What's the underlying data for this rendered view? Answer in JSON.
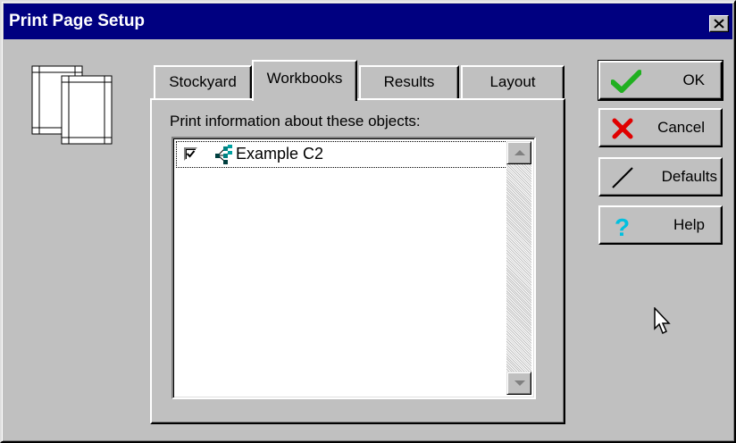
{
  "window": {
    "title": "Print Page Setup"
  },
  "icons": {
    "close": "close-icon",
    "page_setup": "pages-icon",
    "object_tree": "tree-icon",
    "ok": "checkmark-icon",
    "cancel": "x-icon",
    "defaults": "slash-icon",
    "help": "question-icon",
    "cursor": "mouse-pointer-icon"
  },
  "tabs": [
    {
      "label": "Stockyard",
      "active": false
    },
    {
      "label": "Workbooks",
      "active": true
    },
    {
      "label": "Results",
      "active": false
    },
    {
      "label": "Layout",
      "active": false
    }
  ],
  "panel": {
    "label": "Print information about these objects:",
    "items": [
      {
        "label": "Example C2",
        "checked": true
      }
    ]
  },
  "buttons": {
    "ok": "OK",
    "cancel": "Cancel",
    "defaults": "Defaults",
    "help": "Help"
  },
  "colors": {
    "titlebar": "#000080",
    "face": "#c0c0c0",
    "ok_check": "#20b020",
    "cancel_x": "#e00000",
    "help_q": "#00c0e0"
  }
}
